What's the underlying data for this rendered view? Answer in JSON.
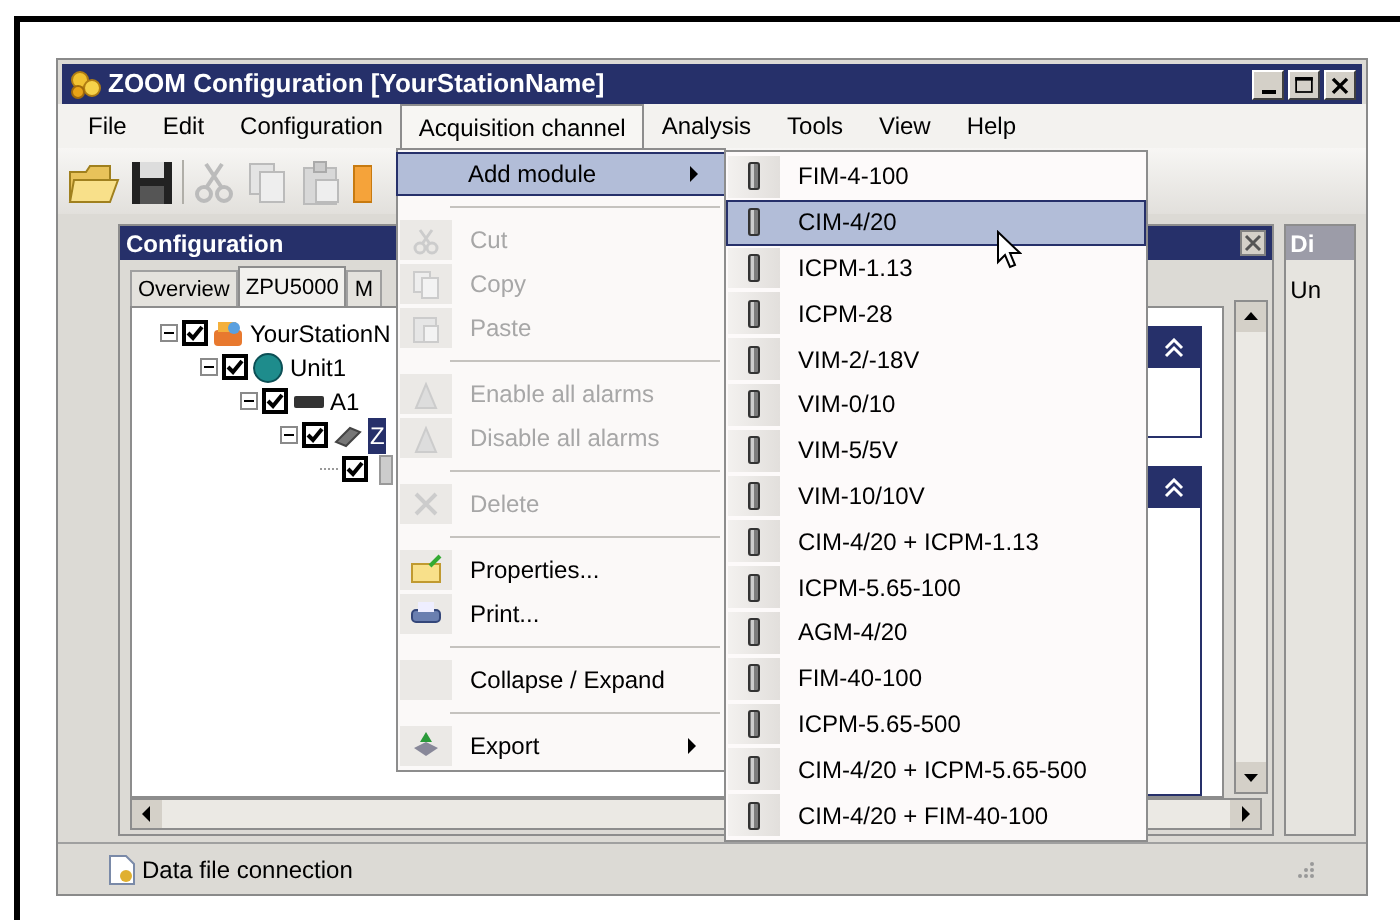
{
  "window": {
    "title": "ZOOM Configuration [YourStationName]"
  },
  "menu_bar": [
    {
      "label": "File",
      "selected": false
    },
    {
      "label": "Edit",
      "selected": false
    },
    {
      "label": "Configuration",
      "selected": false
    },
    {
      "label": "Acquisition channel",
      "selected": true
    },
    {
      "label": "Analysis",
      "selected": false
    },
    {
      "label": "Tools",
      "selected": false
    },
    {
      "label": "View",
      "selected": false
    },
    {
      "label": "Help",
      "selected": false
    }
  ],
  "config_panel": {
    "title": "Configuration",
    "tabs": [
      {
        "label": "Overview",
        "selected": false
      },
      {
        "label": "ZPU5000",
        "selected": true
      },
      {
        "label": "M",
        "selected": false
      }
    ],
    "tree": [
      {
        "label": "YourStationN",
        "checked": true,
        "expanded": true,
        "selected": false,
        "children": [
          {
            "label": "Unit1",
            "checked": true,
            "expanded": true,
            "selected": false,
            "children": [
              {
                "label": "A1",
                "checked": true,
                "expanded": true,
                "selected": false,
                "children": [
                  {
                    "label": "Z",
                    "checked": true,
                    "expanded": true,
                    "selected": true,
                    "children": [
                      {
                        "checked": true
                      }
                    ]
                  }
                ]
              }
            ]
          }
        ]
      }
    ]
  },
  "side_panel": {
    "title": "Di",
    "text": "Un"
  },
  "dropdown": {
    "groups": [
      [
        {
          "label": "Add module",
          "disabled": false,
          "submenu": true,
          "selected": true
        }
      ],
      [
        {
          "label": "Cut",
          "disabled": true,
          "submenu": false,
          "selected": false
        },
        {
          "label": "Copy",
          "disabled": true,
          "submenu": false,
          "selected": false
        },
        {
          "label": "Paste",
          "disabled": true,
          "submenu": false,
          "selected": false
        }
      ],
      [
        {
          "label": "Enable all alarms",
          "disabled": true,
          "submenu": false,
          "selected": false
        },
        {
          "label": "Disable all alarms",
          "disabled": true,
          "submenu": false,
          "selected": false
        }
      ],
      [
        {
          "label": "Delete",
          "disabled": true,
          "submenu": false,
          "selected": false
        }
      ],
      [
        {
          "label": "Properties...",
          "disabled": false,
          "submenu": false,
          "selected": false
        },
        {
          "label": "Print...",
          "disabled": false,
          "submenu": false,
          "selected": false
        }
      ],
      [
        {
          "label": "Collapse / Expand",
          "disabled": false,
          "submenu": false,
          "selected": false
        }
      ],
      [
        {
          "label": "Export",
          "disabled": false,
          "submenu": true,
          "selected": false
        }
      ]
    ]
  },
  "submenu": [
    {
      "label": "FIM-4-100",
      "selected": false
    },
    {
      "label": "CIM-4/20",
      "selected": true
    },
    {
      "label": "ICPM-1.13",
      "selected": false
    },
    {
      "label": "ICPM-28",
      "selected": false
    },
    {
      "label": "VIM-2/-18V",
      "selected": false
    },
    {
      "label": "VIM-0/10",
      "selected": false
    },
    {
      "label": "VIM-5/5V",
      "selected": false
    },
    {
      "label": "VIM-10/10V",
      "selected": false
    },
    {
      "label": "CIM-4/20 + ICPM-1.13",
      "selected": false
    },
    {
      "label": "ICPM-5.65-100",
      "selected": false
    },
    {
      "label": "AGM-4/20",
      "selected": false
    },
    {
      "label": "FIM-40-100",
      "selected": false
    },
    {
      "label": "ICPM-5.65-500",
      "selected": false
    },
    {
      "label": "CIM-4/20 + ICPM-5.65-500",
      "selected": false
    },
    {
      "label": "CIM-4/20 + FIM-40-100",
      "selected": false
    }
  ],
  "status_bar": {
    "text": "Data file connection"
  }
}
